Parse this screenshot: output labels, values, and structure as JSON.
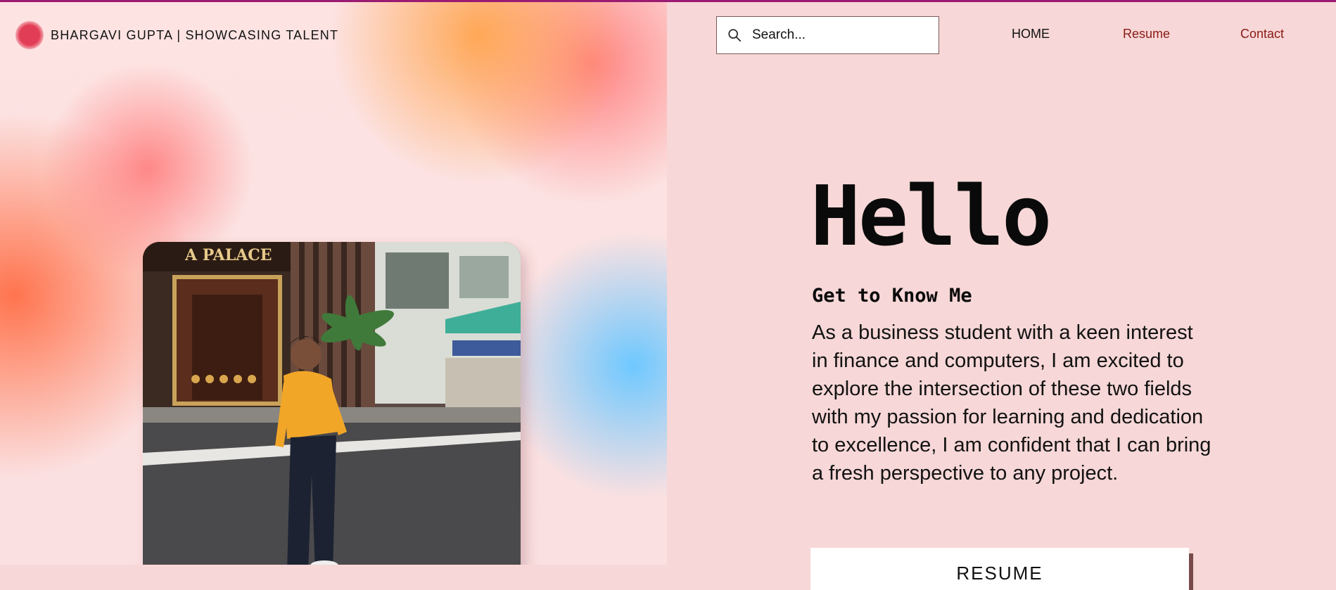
{
  "brand": {
    "name": "BHARGAVI GUPTA | SHOWCASING TALENT",
    "accent_color": "#e23d56"
  },
  "search": {
    "placeholder": "Search...",
    "icon": "search-icon"
  },
  "nav": {
    "items": [
      {
        "label": "HOME"
      },
      {
        "label": "Resume"
      },
      {
        "label": "Contact"
      }
    ]
  },
  "hero": {
    "title": "Hello",
    "subtitle": "Get to Know Me",
    "body": "As a business student with a keen interest in finance and computers, I am excited to explore the intersection of these two fields with my passion for learning and dedication to excellence, I am confident that I can bring a fresh perspective to any project.",
    "button_label": "RESUME"
  },
  "photo": {
    "sign_text": "A PALACE",
    "description": "woman in yellow shirt walking on street"
  },
  "colors": {
    "panel_background": "#f7d7d7",
    "nav_link": "#8a1a14",
    "top_accent": "#9b1b72",
    "button_shadow": "#7a4a4a"
  }
}
